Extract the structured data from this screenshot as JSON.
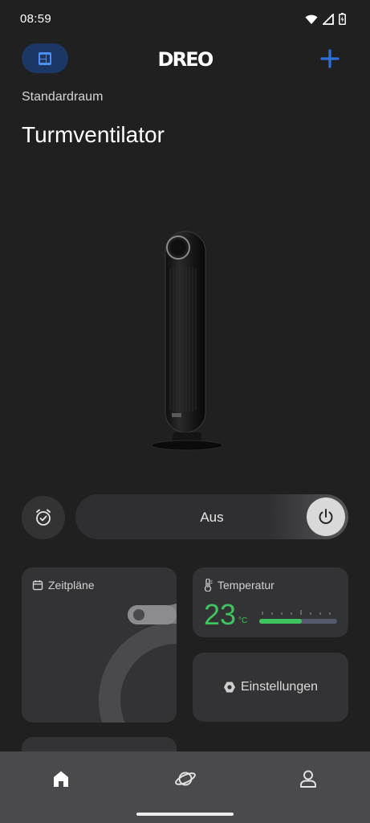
{
  "status_bar": {
    "time": "08:59",
    "icons": [
      "wifi-icon",
      "signal-icon",
      "battery-charging-icon"
    ]
  },
  "header": {
    "logo": "DREO",
    "device_switch_icon": "device-grid-icon",
    "add_icon": "plus-icon"
  },
  "room": "Standardraum",
  "device_name": "Turmventilator",
  "controls": {
    "timer_icon": "alarm-clock-check-icon",
    "power_state": "Aus",
    "power_icon": "power-icon"
  },
  "cards": {
    "schedules": {
      "label": "Zeitpläne",
      "icon": "calendar-icon"
    },
    "temperature": {
      "label": "Temperatur",
      "icon": "thermometer-icon",
      "value": "23",
      "unit": "°C",
      "level": 0.55
    },
    "settings": {
      "label": "Einstellungen",
      "icon": "hexagon-settings-icon"
    }
  },
  "bottom_nav": {
    "items": [
      "home-icon",
      "planet-icon",
      "profile-icon"
    ]
  },
  "colors": {
    "background": "#202020",
    "card": "#333335",
    "accent_blue": "#2f6fdc",
    "temp_green": "#3ec35e",
    "nav": "#4a4a4c"
  }
}
